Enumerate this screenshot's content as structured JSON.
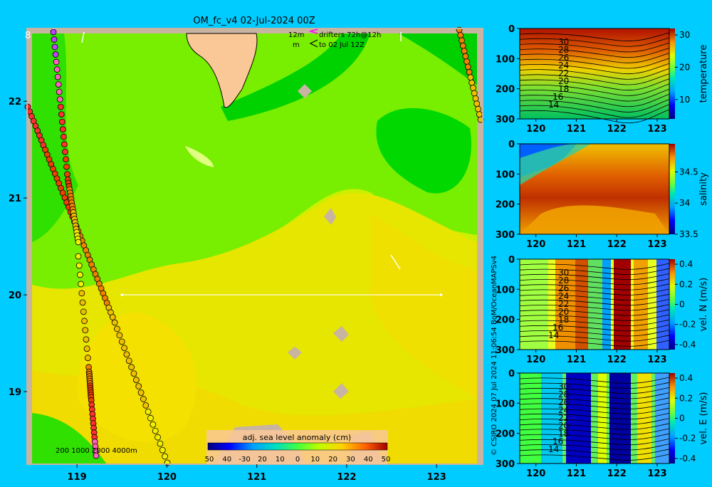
{
  "header": {
    "title": "OM_fc_v4  02-Jul-2024 00Z",
    "corner_glyph": "8",
    "drifter_depth": "12m",
    "drifter_legend": "drifters 72h@12h",
    "drifter_unit": "m",
    "drifter_to": "to 02 Jul 12Z"
  },
  "map": {
    "x_ticks": [
      "119",
      "120",
      "121",
      "122",
      "123"
    ],
    "y_ticks": [
      "22",
      "21",
      "20",
      "19"
    ],
    "colorbar_title": "adj. sea level anomaly (cm)",
    "colorbar_ticks": [
      "50",
      "40",
      "-30",
      "20",
      "10",
      "0",
      "10",
      "20",
      "30",
      "40",
      "50"
    ],
    "depth_legend": "200  1000  2000  4000m"
  },
  "side_text": {
    "credit": "© CSIRO 2024    07 Jul 2024 11:06:54 BoM/OceanMAPSv4"
  },
  "colors": {
    "background": "#00ccff",
    "land": "#fac896",
    "frame": "#c8b4a0"
  },
  "chart_data": [
    {
      "type": "heatmap",
      "title": "adj. sea level anomaly (cm)",
      "xlim": [
        118.5,
        123.45
      ],
      "ylim": [
        18.25,
        22.7
      ],
      "xticks": [
        119,
        120,
        121,
        122,
        123
      ],
      "yticks": [
        19,
        20,
        21,
        22
      ],
      "colorbar_range": [
        -50,
        50
      ],
      "section_line": {
        "lat": 20.0,
        "lon": [
          119.5,
          123.05
        ]
      }
    },
    {
      "type": "heatmap",
      "ylabel": "temperature",
      "xlim": [
        119.6,
        123.3
      ],
      "ylim": [
        300,
        0
      ],
      "xticks": [
        120,
        121,
        122,
        123
      ],
      "yticks": [
        0,
        100,
        200,
        300
      ],
      "colorbar_ticks": [
        10,
        20,
        30
      ],
      "contour_labels": [
        "30",
        "28",
        "26",
        "24",
        "22",
        "20",
        "18",
        "16",
        "14"
      ]
    },
    {
      "type": "heatmap",
      "ylabel": "salinity",
      "xlim": [
        119.6,
        123.3
      ],
      "ylim": [
        300,
        0
      ],
      "xticks": [
        120,
        121,
        122,
        123
      ],
      "yticks": [
        0,
        100,
        200,
        300
      ],
      "colorbar_ticks": [
        33.5,
        34,
        34.5
      ]
    },
    {
      "type": "heatmap",
      "ylabel": "vel. N (m/s)",
      "xlim": [
        119.6,
        123.3
      ],
      "ylim": [
        300,
        0
      ],
      "xticks": [
        120,
        121,
        122,
        123
      ],
      "yticks": [
        0,
        100,
        200,
        300
      ],
      "colorbar_ticks": [
        -0.4,
        -0.2,
        0,
        0.2,
        0.4
      ],
      "contour_labels": [
        "30",
        "28",
        "26",
        "24",
        "22",
        "20",
        "18",
        "16",
        "14"
      ]
    },
    {
      "type": "heatmap",
      "ylabel": "vel. E (m/s)",
      "xlim": [
        119.6,
        123.3
      ],
      "ylim": [
        300,
        0
      ],
      "xticks": [
        120,
        121,
        122,
        123
      ],
      "yticks": [
        0,
        100,
        200,
        300
      ],
      "colorbar_ticks": [
        -0.4,
        -0.2,
        0,
        0.2,
        0.4
      ],
      "contour_labels": [
        "30",
        "28",
        "26",
        "24",
        "22",
        "20",
        "18",
        "16",
        "14"
      ]
    }
  ]
}
